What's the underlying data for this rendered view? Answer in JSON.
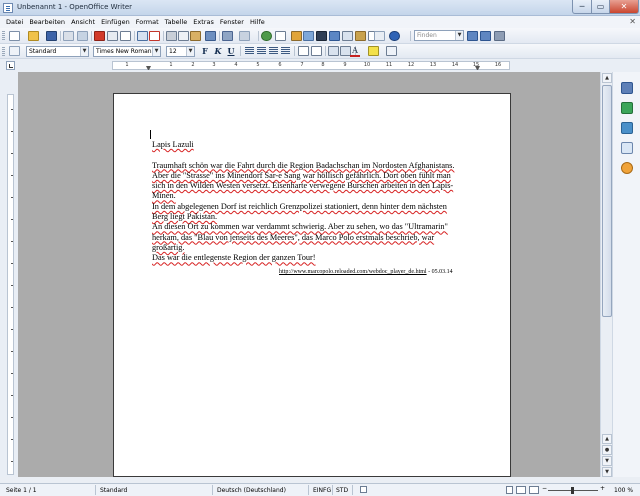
{
  "window": {
    "title": "Unbenannt 1 - OpenOffice Writer",
    "minimize_label": "─",
    "maximize_label": "▭",
    "close_label": "✕"
  },
  "menu": {
    "items": [
      "Datei",
      "Bearbeiten",
      "Ansicht",
      "Einfügen",
      "Format",
      "Tabelle",
      "Extras",
      "Fenster",
      "Hilfe"
    ],
    "close_label": "✕"
  },
  "toolbar": {
    "find_placeholder": "Finden",
    "style": "Standard",
    "font": "Times New Roman",
    "size": "12",
    "bold": "F",
    "italic": "K",
    "underline": "U"
  },
  "ruler": {
    "numbers": [
      "1",
      "1",
      "2",
      "3",
      "4",
      "5",
      "6",
      "7",
      "8",
      "9",
      "10",
      "11",
      "12",
      "13",
      "14",
      "15",
      "16",
      "17"
    ]
  },
  "document": {
    "title": "Lapis Lazuli",
    "lines": [
      "Traumhaft schön war die Fahrt durch die Region Badachschan im Nordosten Afghanistans.",
      "Aber die \"Strasse\" ins Minendorf Sar-e Sang war höllisch gefährlich. Dort oben fühlt man",
      "sich in den Wilden Westen versetzt. Eisenharte verwegene Burschen arbeiten in den Lapis-",
      "Minen.",
      "In dem abgelegenen Dorf ist reichlich Grenzpolizei stationiert, denn hinter dem nächsten",
      "Berg liegt Pakistan.",
      "An diesen Ort zu kommen war verdammt schwierig. Aber zu sehen, wo das \"Ultramarin\"",
      "herkam, das \"Blau von jenseits des Meeres\", das Marco Polo erstmals beschrieb, war",
      "großartig.",
      "Das war die entlegenste Region der ganzen Tour!"
    ],
    "link_url": "http://www.marcopolo.reloaded.com/webdoc_player_de.html",
    "link_date": " - 05.03.14"
  },
  "status": {
    "page": "Seite 1 / 1",
    "style": "Standard",
    "language": "Deutsch (Deutschland)",
    "insert_mode": "EINFG",
    "selection_mode": "STD",
    "zoom": "100 %"
  },
  "colors": {
    "accent": "#3a6fb0",
    "doc_background": "#ababab",
    "spelling": "#d62020"
  }
}
